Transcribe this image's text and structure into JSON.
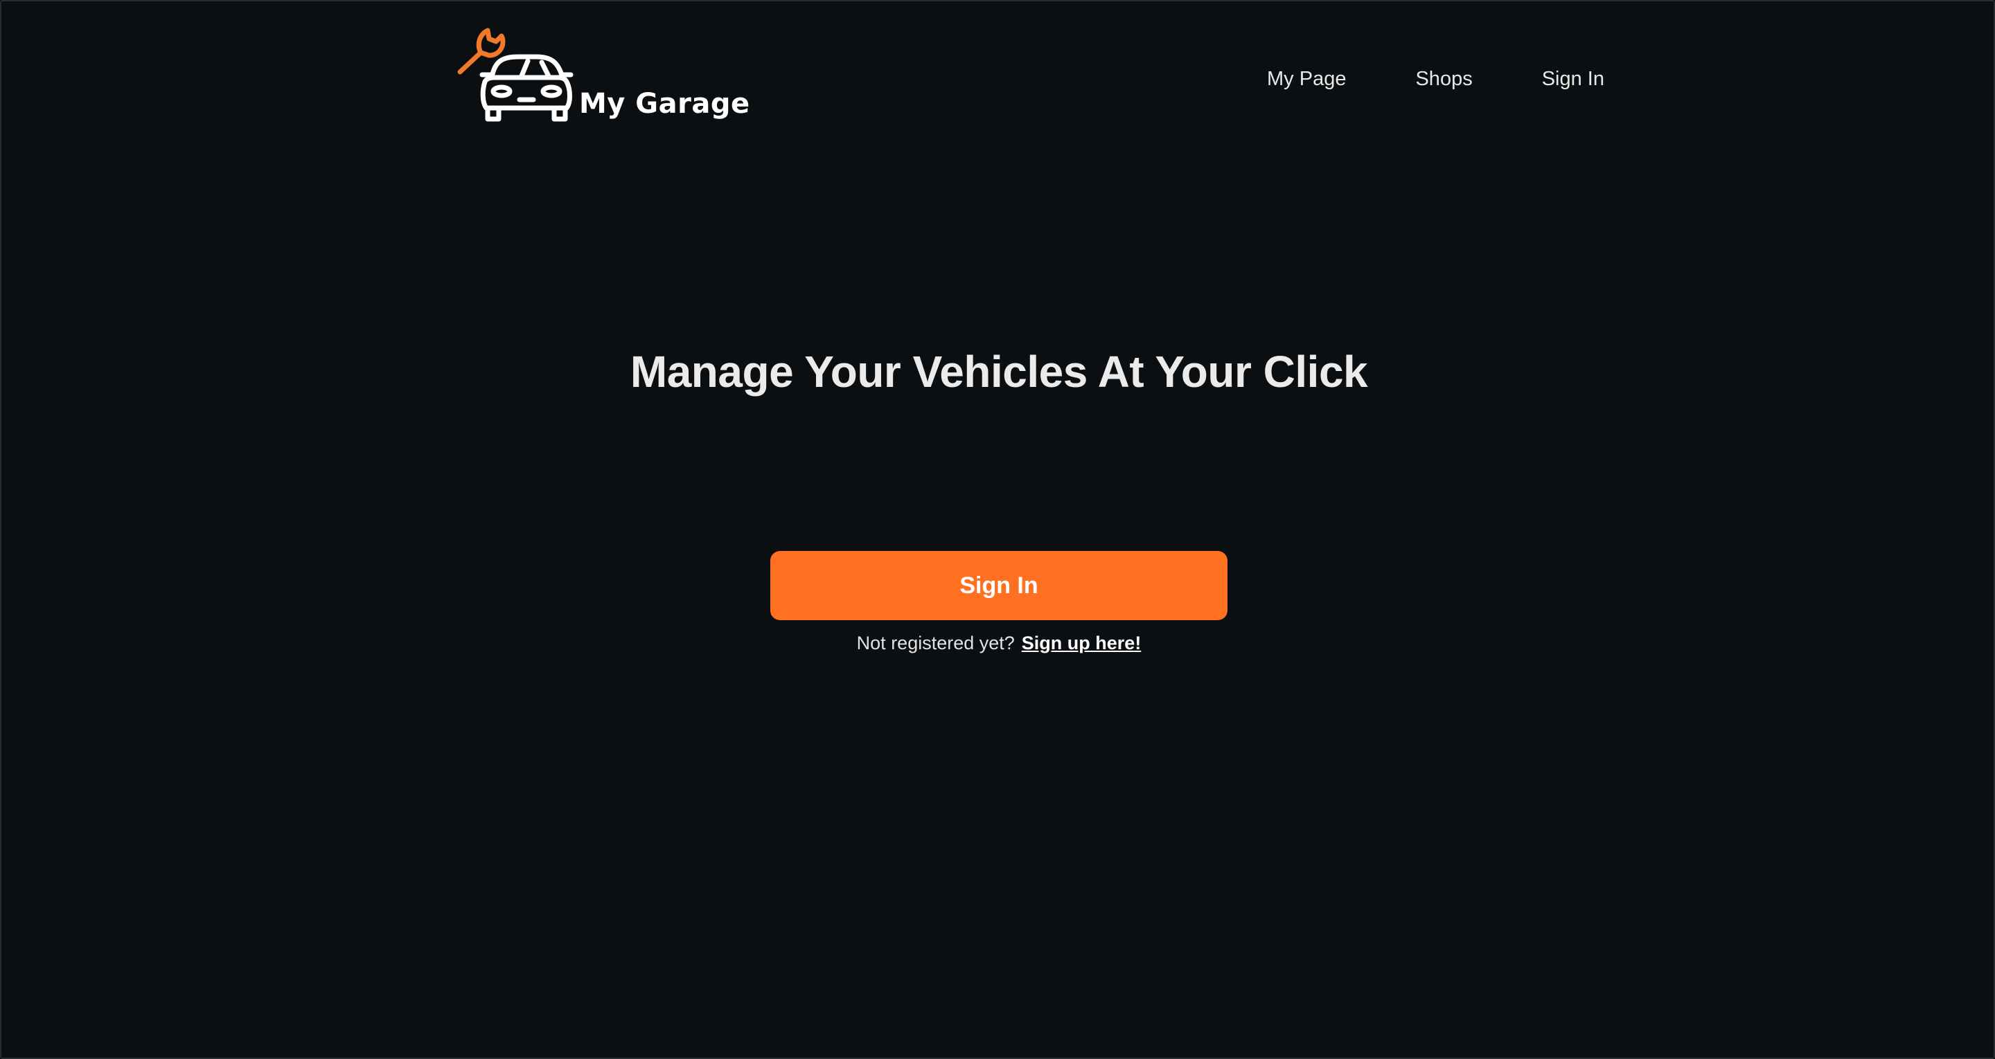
{
  "header": {
    "brand_name": "My Garage",
    "logo_icon": "car-wrench-icon",
    "nav": [
      {
        "label": "My Page"
      },
      {
        "label": "Shops"
      },
      {
        "label": "Sign In"
      }
    ]
  },
  "hero": {
    "title": "Manage Your Vehicles At Your Click",
    "signin_button": "Sign In",
    "register_prompt": "Not registered yet?",
    "signup_link": "Sign up here!"
  },
  "colors": {
    "background": "#0c0f12",
    "accent": "#ff7020",
    "text": "#ececec"
  }
}
